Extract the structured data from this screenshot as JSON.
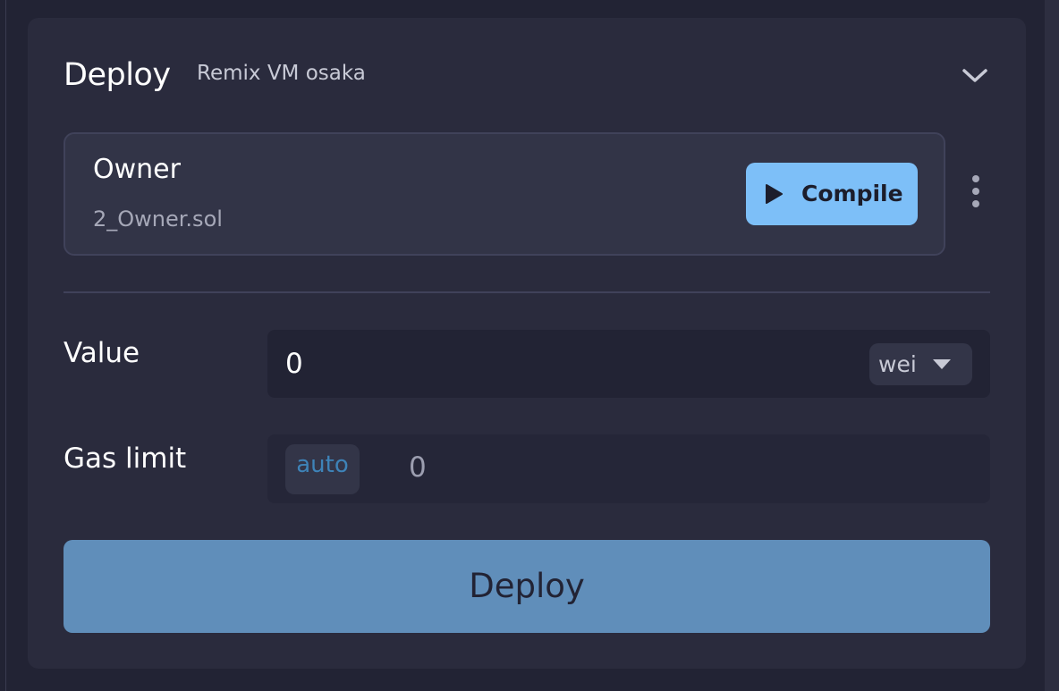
{
  "deploy_panel": {
    "title": "Deploy",
    "environment": "Remix VM osaka"
  },
  "contract": {
    "name": "Owner",
    "file": "2_Owner.sol",
    "compile_label": "Compile"
  },
  "value": {
    "label": "Value",
    "amount": "0",
    "unit": "wei"
  },
  "gas": {
    "label": "Gas limit",
    "mode": "auto",
    "amount": "0"
  },
  "deploy_button": {
    "label": "Deploy"
  },
  "colors": {
    "accent": "#7dbff8",
    "deploy_button": "#608eba",
    "panel": "#2a2b3d",
    "background": "#222334"
  },
  "icons": [
    "chevron-down-icon",
    "play-icon",
    "more-vertical-icon",
    "caret-down-icon"
  ]
}
